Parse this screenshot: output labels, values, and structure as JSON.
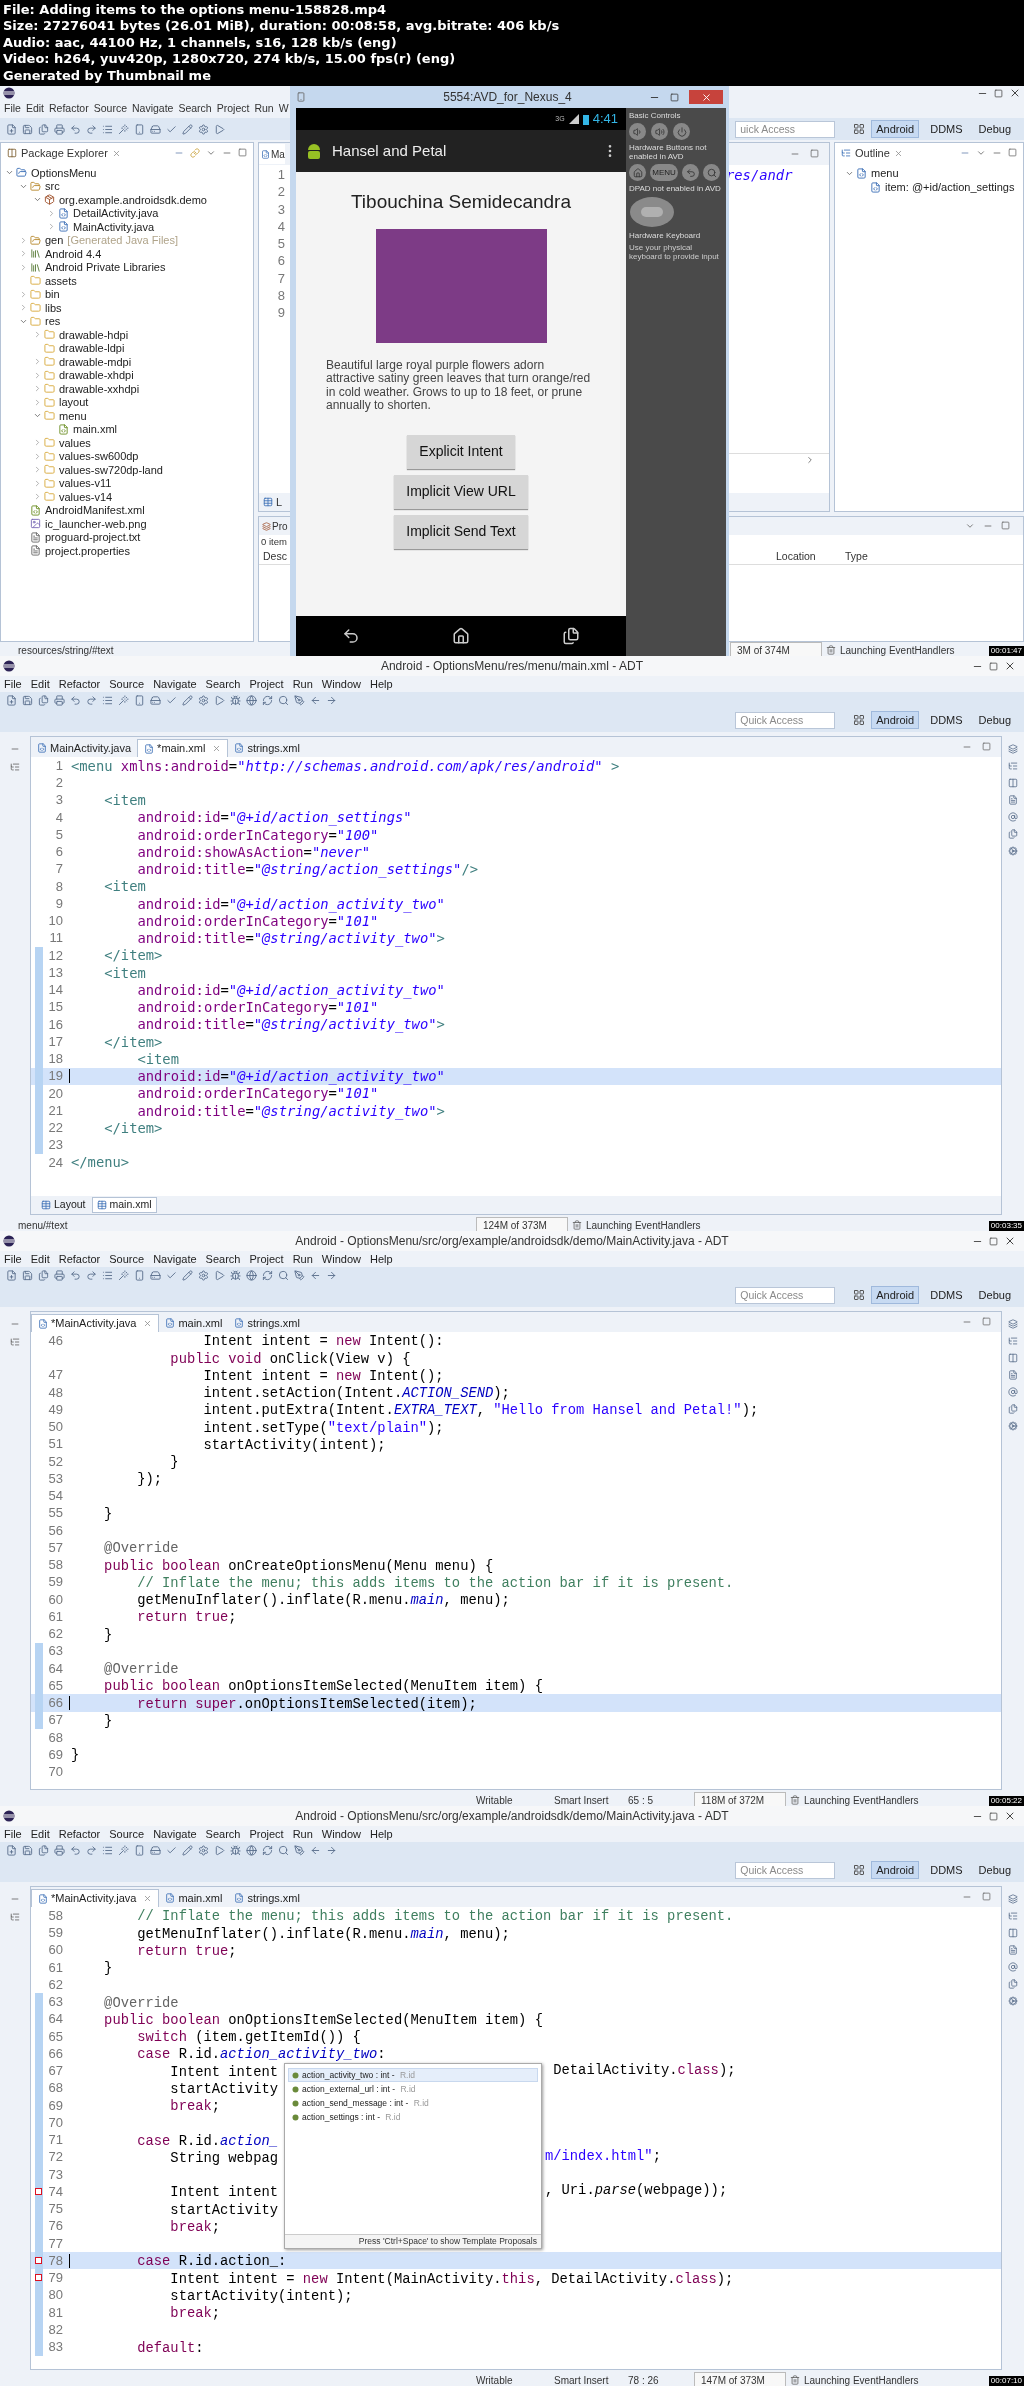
{
  "header": [
    "File: Adding items to the options menu-158828.mp4",
    "Size: 27276041 bytes (26.01 MiB), duration: 00:08:58, avg.bitrate: 406 kb/s",
    "Audio: aac, 44100 Hz, 1 channels, s16, 128 kb/s (eng)",
    "Video: h264, yuv420p, 1280x720, 274 kb/s, 15.00 fps(r) (eng)",
    "Generated by Thumbnail me"
  ],
  "frames": [
    {
      "kind": "emulator",
      "timestamp": "00:01:47",
      "ide": {
        "menu": [
          "File",
          "Edit",
          "Refactor",
          "Source",
          "Navigate",
          "Search",
          "Project",
          "Run",
          "W"
        ],
        "package_explorer": {
          "title": "Package Explorer",
          "tree": [
            {
              "label": "OptionsMenu",
              "kind": "project",
              "expanded": true,
              "children": [
                {
                  "label": "src",
                  "kind": "source-folder",
                  "expanded": true,
                  "children": [
                    {
                      "label": "org.example.androidsdk.demo",
                      "kind": "package",
                      "expanded": true,
                      "children": [
                        {
                          "label": "DetailActivity.java",
                          "kind": "java",
                          "expanded": false
                        },
                        {
                          "label": "MainActivity.java",
                          "kind": "java",
                          "expanded": false
                        }
                      ]
                    }
                  ]
                },
                {
                  "label": "gen",
                  "note": "[Generated Java Files]",
                  "kind": "source-folder",
                  "expanded": false
                },
                {
                  "label": "Android 4.4",
                  "kind": "library",
                  "expanded": false
                },
                {
                  "label": "Android Private Libraries",
                  "kind": "library",
                  "expanded": false
                },
                {
                  "label": "assets",
                  "kind": "folder"
                },
                {
                  "label": "bin",
                  "kind": "folder",
                  "expanded": false
                },
                {
                  "label": "libs",
                  "kind": "folder",
                  "expanded": false
                },
                {
                  "label": "res",
                  "kind": "folder",
                  "expanded": true,
                  "children": [
                    {
                      "label": "drawable-hdpi",
                      "kind": "folder",
                      "expanded": false
                    },
                    {
                      "label": "drawable-ldpi",
                      "kind": "folder"
                    },
                    {
                      "label": "drawable-mdpi",
                      "kind": "folder",
                      "expanded": false
                    },
                    {
                      "label": "drawable-xhdpi",
                      "kind": "folder",
                      "expanded": false
                    },
                    {
                      "label": "drawable-xxhdpi",
                      "kind": "folder",
                      "expanded": false
                    },
                    {
                      "label": "layout",
                      "kind": "folder",
                      "expanded": false
                    },
                    {
                      "label": "menu",
                      "kind": "folder",
                      "expanded": true,
                      "children": [
                        {
                          "label": "main.xml",
                          "kind": "xml"
                        }
                      ]
                    },
                    {
                      "label": "values",
                      "kind": "folder",
                      "expanded": false
                    },
                    {
                      "label": "values-sw600dp",
                      "kind": "folder",
                      "expanded": false
                    },
                    {
                      "label": "values-sw720dp-land",
                      "kind": "folder",
                      "expanded": false
                    },
                    {
                      "label": "values-v11",
                      "kind": "folder",
                      "expanded": false
                    },
                    {
                      "label": "values-v14",
                      "kind": "folder",
                      "expanded": false
                    }
                  ]
                },
                {
                  "label": "AndroidManifest.xml",
                  "kind": "xml"
                },
                {
                  "label": "ic_launcher-web.png",
                  "kind": "image"
                },
                {
                  "label": "proguard-project.txt",
                  "kind": "text"
                },
                {
                  "label": "project.properties",
                  "kind": "text"
                }
              ]
            }
          ]
        },
        "editor_tab": "Ma",
        "line_numbers": [
          "1",
          "2",
          "3",
          "4",
          "5",
          "6",
          "7",
          "8",
          "9"
        ],
        "editor_fragment": "res/andr",
        "bottom_tab": "L",
        "quick_access": {
          "placeholder": "uick Access"
        },
        "perspectives": [
          {
            "label": "Android",
            "selected": true
          },
          {
            "label": "DDMS",
            "selected": false
          },
          {
            "label": "Debug",
            "selected": false
          }
        ],
        "outline": {
          "title": "Outline",
          "tree": [
            {
              "label": "menu",
              "expanded": true,
              "children": [
                {
                  "label": "item: @+id/action_settings"
                }
              ]
            }
          ]
        },
        "problems": {
          "tab": "Pro",
          "count": "0 item",
          "columns": [
            "Desc",
            "Location",
            "Type"
          ]
        },
        "status": {
          "path": "resources/string/#text",
          "memory": "3M of 374M",
          "job": "Launching EventHandlers"
        }
      },
      "emulator": {
        "title": "5554:AVD_for_Nexus_4",
        "network": "3G",
        "time": "4:41",
        "app_title": "Hansel and Petal",
        "heading": "Tibouchina Semidecandra",
        "description": "Beautiful large royal purple flowers adorn attractive satiny green leaves that turn orange/red in cold weather. Grows to up to 18 feet, or prune annually to shorten.",
        "buttons": [
          "Explicit Intent",
          "Implicit View URL",
          "Implicit Send Text"
        ],
        "controls": {
          "basic": "Basic Controls",
          "hardware": "Hardware Buttons not enabled in AVD",
          "menu_key": "MENU",
          "dpad": "DPAD not enabled in AVD",
          "keyboard": "Hardware Keyboard",
          "keyboard_hint": "Use your physical keyboard to provide input"
        }
      }
    },
    {
      "kind": "xml-editor",
      "timestamp": "00:03:35",
      "title": "Android - OptionsMenu/res/menu/main.xml - ADT",
      "menu": [
        "File",
        "Edit",
        "Refactor",
        "Source",
        "Navigate",
        "Search",
        "Project",
        "Run",
        "Window",
        "Help"
      ],
      "quick_access": {
        "placeholder": "Quick Access"
      },
      "perspectives": [
        {
          "label": "Android",
          "selected": true
        },
        {
          "label": "DDMS",
          "selected": false
        },
        {
          "label": "Debug",
          "selected": false
        }
      ],
      "tabs": [
        {
          "label": "MainActivity.java",
          "selected": false
        },
        {
          "label": "*main.xml",
          "selected": true
        },
        {
          "label": "strings.xml",
          "selected": false
        }
      ],
      "lines": [
        {
          "number": "1",
          "changed": false,
          "current": false,
          "segments": [
            {
              "text": "<menu",
              "kind": "tag"
            },
            {
              "text": " xmlns:android",
              "kind": "attr"
            },
            {
              "text": "=",
              "kind": "plain"
            },
            {
              "text": "\"http://schemas.android.com/apk/res/android\"",
              "kind": "value"
            },
            {
              "text": " >",
              "kind": "tag"
            }
          ]
        },
        {
          "number": "2",
          "changed": false,
          "current": false
        },
        {
          "number": "3",
          "changed": false,
          "current": false,
          "segments": [
            {
              "text": "    <item",
              "kind": "tag"
            }
          ]
        },
        {
          "number": "4",
          "changed": false,
          "current": false,
          "segments": [
            {
              "text": "        android:id",
              "kind": "attr"
            },
            {
              "text": "=",
              "kind": "plain"
            },
            {
              "text": "\"@+id/action_settings\"",
              "kind": "value"
            }
          ]
        },
        {
          "number": "5",
          "changed": false,
          "current": false,
          "segments": [
            {
              "text": "        android:orderInCategory",
              "kind": "attr"
            },
            {
              "text": "=",
              "kind": "plain"
            },
            {
              "text": "\"100\"",
              "kind": "value"
            }
          ]
        },
        {
          "number": "6",
          "changed": false,
          "current": false,
          "segments": [
            {
              "text": "        android:showAsAction",
              "kind": "attr"
            },
            {
              "text": "=",
              "kind": "plain"
            },
            {
              "text": "\"never\"",
              "kind": "value"
            }
          ]
        },
        {
          "number": "7",
          "changed": false,
          "current": false,
          "segments": [
            {
              "text": "        android:title",
              "kind": "attr"
            },
            {
              "text": "=",
              "kind": "plain"
            },
            {
              "text": "\"@string/action_settings\"",
              "kind": "value"
            },
            {
              "text": "/>",
              "kind": "tag"
            }
          ]
        },
        {
          "number": "8",
          "changed": false,
          "current": false,
          "segments": [
            {
              "text": "    <item",
              "kind": "tag"
            }
          ]
        },
        {
          "number": "9",
          "changed": false,
          "current": false,
          "segments": [
            {
              "text": "        android:id",
              "kind": "attr"
            },
            {
              "text": "=",
              "kind": "plain"
            },
            {
              "text": "\"@+id/action_activity_two\"",
              "kind": "value"
            }
          ]
        },
        {
          "number": "10",
          "changed": false,
          "current": false,
          "segments": [
            {
              "text": "        android:orderInCategory",
              "kind": "attr"
            },
            {
              "text": "=",
              "kind": "plain"
            },
            {
              "text": "\"101\"",
              "kind": "value"
            }
          ]
        },
        {
          "number": "11",
          "changed": false,
          "current": false,
          "segments": [
            {
              "text": "        android:title",
              "kind": "attr"
            },
            {
              "text": "=",
              "kind": "plain"
            },
            {
              "text": "\"@string/activity_two\"",
              "kind": "value"
            },
            {
              "text": ">",
              "kind": "tag"
            }
          ]
        },
        {
          "number": "12",
          "changed": true,
          "current": false,
          "segments": [
            {
              "text": "    </item>",
              "kind": "tag"
            }
          ]
        },
        {
          "number": "13",
          "changed": true,
          "current": false,
          "segments": [
            {
              "text": "    <item",
              "kind": "tag"
            }
          ]
        },
        {
          "number": "14",
          "changed": true,
          "current": false,
          "segments": [
            {
              "text": "        android:id",
              "kind": "attr"
            },
            {
              "text": "=",
              "kind": "plain"
            },
            {
              "text": "\"@+id/action_activity_two\"",
              "kind": "value"
            }
          ]
        },
        {
          "number": "15",
          "changed": true,
          "current": false,
          "segments": [
            {
              "text": "        android:orderInCategory",
              "kind": "attr"
            },
            {
              "text": "=",
              "kind": "plain"
            },
            {
              "text": "\"101\"",
              "kind": "value"
            }
          ]
        },
        {
          "number": "16",
          "changed": true,
          "current": false,
          "segments": [
            {
              "text": "        android:title",
              "kind": "attr"
            },
            {
              "text": "=",
              "kind": "plain"
            },
            {
              "text": "\"@string/activity_two\"",
              "kind": "value"
            },
            {
              "text": ">",
              "kind": "tag"
            }
          ]
        },
        {
          "number": "17",
          "changed": true,
          "current": false,
          "segments": [
            {
              "text": "    </item>",
              "kind": "tag"
            }
          ]
        },
        {
          "number": "18",
          "changed": true,
          "current": false,
          "segments": [
            {
              "text": "        <item",
              "kind": "tag"
            }
          ]
        },
        {
          "number": "19",
          "changed": true,
          "current": true,
          "segments": [
            {
              "text": "        android:id",
              "kind": "attr"
            },
            {
              "text": "=",
              "kind": "plain"
            },
            {
              "text": "\"@+id/action_activity_two\"",
              "kind": "value"
            }
          ]
        },
        {
          "number": "20",
          "changed": true,
          "current": false,
          "segments": [
            {
              "text": "        android:orderInCategory",
              "kind": "attr"
            },
            {
              "text": "=",
              "kind": "plain"
            },
            {
              "text": "\"101\"",
              "kind": "value"
            }
          ]
        },
        {
          "number": "21",
          "changed": true,
          "current": false,
          "segments": [
            {
              "text": "        android:title",
              "kind": "attr"
            },
            {
              "text": "=",
              "kind": "plain"
            },
            {
              "text": "\"@string/activity_two\"",
              "kind": "value"
            },
            {
              "text": ">",
              "kind": "tag"
            }
          ]
        },
        {
          "number": "22",
          "changed": true,
          "current": false,
          "segments": [
            {
              "text": "    </item>",
              "kind": "tag"
            }
          ]
        },
        {
          "number": "23",
          "changed": true,
          "current": false
        },
        {
          "number": "24",
          "changed": false,
          "current": false,
          "segments": [
            {
              "text": "</menu>",
              "kind": "tag"
            }
          ]
        }
      ],
      "bottom_tabs": [
        {
          "label": "Layout",
          "selected": false
        },
        {
          "label": "main.xml",
          "selected": true
        }
      ],
      "status": {
        "path": "menu/#text",
        "memory": "124M of 373M",
        "job": "Launching EventHandlers"
      }
    },
    {
      "kind": "java-editor",
      "timestamp": "00:05:22",
      "title": "Android - OptionsMenu/src/org/example/androidsdk/demo/MainActivity.java - ADT",
      "menu": [
        "File",
        "Edit",
        "Refactor",
        "Source",
        "Navigate",
        "Search",
        "Project",
        "Run",
        "Window",
        "Help"
      ],
      "quick_access": {
        "placeholder": "Quick Access"
      },
      "perspectives": [
        {
          "label": "Android",
          "selected": true
        },
        {
          "label": "DDMS",
          "selected": false
        },
        {
          "label": "Debug",
          "selected": false
        }
      ],
      "tabs": [
        {
          "label": "*MainActivity.java",
          "selected": true
        },
        {
          "label": "main.xml",
          "selected": false
        },
        {
          "label": "strings.xml",
          "selected": false
        }
      ],
      "lines": [
        {
          "number": "46",
          "changed": false,
          "current": false,
          "segments": [
            {
              "text": "                Intent intent = ",
              "kind": "plain"
            },
            {
              "text": "new",
              "kind": "keyword"
            },
            {
              "text": " Intent():",
              "kind": "plain"
            }
          ]
        },
        {
          "changed": false,
          "current": false,
          "segments": [
            {
              "text": "            public void",
              "kind": "keyword"
            },
            {
              "text": " onClick(View v) {",
              "kind": "plain"
            }
          ]
        },
        {
          "number": "47",
          "changed": false,
          "current": false,
          "segments": [
            {
              "text": "                Intent intent = ",
              "kind": "plain"
            },
            {
              "text": "new",
              "kind": "keyword"
            },
            {
              "text": " Intent();",
              "kind": "plain"
            }
          ]
        },
        {
          "number": "48",
          "changed": false,
          "current": false,
          "segments": [
            {
              "text": "                intent.setAction(Intent.",
              "kind": "plain"
            },
            {
              "text": "ACTION_SEND",
              "kind": "field"
            },
            {
              "text": ");",
              "kind": "plain"
            }
          ]
        },
        {
          "number": "49",
          "changed": false,
          "current": false,
          "segments": [
            {
              "text": "                intent.putExtra(Intent.",
              "kind": "plain"
            },
            {
              "text": "EXTRA_TEXT",
              "kind": "field"
            },
            {
              "text": ", ",
              "kind": "plain"
            },
            {
              "text": "\"Hello from Hansel and Petal!\"",
              "kind": "string"
            },
            {
              "text": ");",
              "kind": "plain"
            }
          ]
        },
        {
          "number": "50",
          "changed": false,
          "current": false,
          "segments": [
            {
              "text": "                intent.setType(",
              "kind": "plain"
            },
            {
              "text": "\"text/plain\"",
              "kind": "string"
            },
            {
              "text": ");",
              "kind": "plain"
            }
          ]
        },
        {
          "number": "51",
          "changed": false,
          "current": false,
          "segments": [
            {
              "text": "                startActivity(intent);",
              "kind": "plain"
            }
          ]
        },
        {
          "number": "52",
          "changed": false,
          "current": false,
          "segments": [
            {
              "text": "            }",
              "kind": "plain"
            }
          ]
        },
        {
          "number": "53",
          "changed": false,
          "current": false,
          "segments": [
            {
              "text": "        });",
              "kind": "plain"
            }
          ]
        },
        {
          "number": "54",
          "changed": false,
          "current": false
        },
        {
          "number": "55",
          "changed": false,
          "current": false,
          "segments": [
            {
              "text": "    }",
              "kind": "plain"
            }
          ]
        },
        {
          "number": "56",
          "changed": false,
          "current": false
        },
        {
          "number": "57",
          "changed": false,
          "current": false,
          "segments": [
            {
              "text": "    @Override",
              "kind": "annotation"
            }
          ]
        },
        {
          "number": "58",
          "changed": false,
          "current": false,
          "segments": [
            {
              "text": "    public boolean",
              "kind": "keyword"
            },
            {
              "text": " onCreateOptionsMenu(Menu menu) {",
              "kind": "plain"
            }
          ]
        },
        {
          "number": "59",
          "changed": false,
          "current": false,
          "segments": [
            {
              "text": "        // Inflate the menu; this adds items to the action bar if it is present.",
              "kind": "comment"
            }
          ]
        },
        {
          "number": "60",
          "changed": false,
          "current": false,
          "segments": [
            {
              "text": "        getMenuInflater().inflate(R.menu.",
              "kind": "plain"
            },
            {
              "text": "main",
              "kind": "field"
            },
            {
              "text": ", menu);",
              "kind": "plain"
            }
          ]
        },
        {
          "number": "61",
          "changed": false,
          "current": false,
          "segments": [
            {
              "text": "        return true",
              "kind": "keyword"
            },
            {
              "text": ";",
              "kind": "plain"
            }
          ]
        },
        {
          "number": "62",
          "changed": false,
          "current": false,
          "segments": [
            {
              "text": "    }",
              "kind": "plain"
            }
          ]
        },
        {
          "number": "63",
          "changed": true,
          "current": false
        },
        {
          "number": "64",
          "changed": true,
          "current": false,
          "segments": [
            {
              "text": "    @Override",
              "kind": "annotation"
            }
          ]
        },
        {
          "number": "65",
          "changed": true,
          "current": false,
          "segments": [
            {
              "text": "    public boolean",
              "kind": "keyword"
            },
            {
              "text": " onOptionsItemSelected(MenuItem item) {",
              "kind": "plain"
            }
          ]
        },
        {
          "number": "66",
          "changed": true,
          "current": true,
          "segments": [
            {
              "text": "        return super",
              "kind": "keyword"
            },
            {
              "text": ".onOptionsItemSelected(item);",
              "kind": "plain"
            }
          ]
        },
        {
          "number": "67",
          "changed": true,
          "current": false,
          "segments": [
            {
              "text": "    }",
              "kind": "plain"
            }
          ]
        },
        {
          "number": "68",
          "changed": false,
          "current": false
        },
        {
          "number": "69",
          "changed": false,
          "current": false,
          "segments": [
            {
              "text": "}",
              "kind": "plain"
            }
          ]
        },
        {
          "number": "70",
          "changed": false,
          "current": false
        }
      ],
      "status": {
        "writable": "Writable",
        "insert_mode": "Smart Insert",
        "position": "65 : 5",
        "memory": "118M of 372M",
        "job": "Launching EventHandlers"
      }
    },
    {
      "kind": "java-editor",
      "timestamp": "00:07:10",
      "title": "Android - OptionsMenu/src/org/example/androidsdk/demo/MainActivity.java - ADT",
      "menu": [
        "File",
        "Edit",
        "Refactor",
        "Source",
        "Navigate",
        "Search",
        "Project",
        "Run",
        "Window",
        "Help"
      ],
      "quick_access": {
        "placeholder": "Quick Access"
      },
      "perspectives": [
        {
          "label": "Android",
          "selected": true
        },
        {
          "label": "DDMS",
          "selected": false
        },
        {
          "label": "Debug",
          "selected": false
        }
      ],
      "tabs": [
        {
          "label": "*MainActivity.java",
          "selected": true
        },
        {
          "label": "main.xml",
          "selected": false
        },
        {
          "label": "strings.xml",
          "selected": false
        }
      ],
      "lines": [
        {
          "number": "58",
          "changed": false,
          "current": false,
          "error": false,
          "segments": [
            {
              "text": "        // Inflate the menu; this adds items to the action bar if it is present.",
              "kind": "comment"
            }
          ]
        },
        {
          "number": "59",
          "changed": false,
          "current": false,
          "error": false,
          "segments": [
            {
              "text": "        getMenuInflater().inflate(R.menu.",
              "kind": "plain"
            },
            {
              "text": "main",
              "kind": "field"
            },
            {
              "text": ", menu);",
              "kind": "plain"
            }
          ]
        },
        {
          "number": "60",
          "changed": false,
          "current": false,
          "error": false,
          "segments": [
            {
              "text": "        return true",
              "kind": "keyword"
            },
            {
              "text": ";",
              "kind": "plain"
            }
          ]
        },
        {
          "number": "61",
          "changed": false,
          "current": false,
          "error": false,
          "segments": [
            {
              "text": "    }",
              "kind": "plain"
            }
          ]
        },
        {
          "number": "62",
          "changed": false,
          "current": false,
          "error": false
        },
        {
          "number": "63",
          "changed": true,
          "current": false,
          "error": false,
          "segments": [
            {
              "text": "    @Override",
              "kind": "annotation"
            }
          ]
        },
        {
          "number": "64",
          "changed": true,
          "current": false,
          "error": false,
          "segments": [
            {
              "text": "    public boolean",
              "kind": "keyword"
            },
            {
              "text": " onOptionsItemSelected(MenuItem item) {",
              "kind": "plain"
            }
          ]
        },
        {
          "number": "65",
          "changed": true,
          "current": false,
          "error": false,
          "segments": [
            {
              "text": "        switch",
              "kind": "keyword"
            },
            {
              "text": " (item.getItemId()) {",
              "kind": "plain"
            }
          ]
        },
        {
          "number": "66",
          "changed": true,
          "current": false,
          "error": false,
          "segments": [
            {
              "text": "        case",
              "kind": "keyword"
            },
            {
              "text": " R.id.",
              "kind": "plain"
            },
            {
              "text": "action_activity_two",
              "kind": "field"
            },
            {
              "text": ":",
              "kind": "plain"
            }
          ]
        },
        {
          "number": "67",
          "changed": true,
          "current": false,
          "error": false,
          "segments": [
            {
              "text": "            Intent intent",
              "kind": "plain"
            }
          ],
          "right": [
            {
              "text": " DetailActivity.",
              "kind": "plain"
            },
            {
              "text": "class",
              "kind": "keyword"
            },
            {
              "text": ");",
              "kind": "plain"
            }
          ]
        },
        {
          "number": "68",
          "changed": true,
          "current": false,
          "error": false,
          "segments": [
            {
              "text": "            startActivity",
              "kind": "plain"
            }
          ]
        },
        {
          "number": "69",
          "changed": true,
          "current": false,
          "error": false,
          "segments": [
            {
              "text": "            break",
              "kind": "keyword"
            },
            {
              "text": ";",
              "kind": "plain"
            }
          ]
        },
        {
          "number": "70",
          "changed": true,
          "current": false,
          "error": false
        },
        {
          "number": "71",
          "changed": true,
          "current": false,
          "error": false,
          "segments": [
            {
              "text": "        case",
              "kind": "keyword"
            },
            {
              "text": " R.id.",
              "kind": "plain"
            },
            {
              "text": "action_",
              "kind": "field"
            }
          ]
        },
        {
          "number": "72",
          "changed": true,
          "current": false,
          "error": false,
          "segments": [
            {
              "text": "            String webpag",
              "kind": "plain"
            }
          ],
          "right": [
            {
              "text": "m/index.html\"",
              "kind": "string"
            },
            {
              "text": ";",
              "kind": "plain"
            }
          ]
        },
        {
          "number": "73",
          "changed": true,
          "current": false,
          "error": false
        },
        {
          "number": "74",
          "changed": true,
          "current": false,
          "error": true,
          "segments": [
            {
              "text": "            Intent intent",
              "kind": "plain"
            }
          ],
          "right": [
            {
              "text": ", Uri.",
              "kind": "plain"
            },
            {
              "text": "parse",
              "kind": "method"
            },
            {
              "text": "(webpage));",
              "kind": "plain"
            }
          ]
        },
        {
          "number": "75",
          "changed": true,
          "current": false,
          "error": false,
          "segments": [
            {
              "text": "            startActivity",
              "kind": "plain"
            }
          ]
        },
        {
          "number": "76",
          "changed": true,
          "current": false,
          "error": false,
          "segments": [
            {
              "text": "            break",
              "kind": "keyword"
            },
            {
              "text": ";",
              "kind": "plain"
            }
          ]
        },
        {
          "number": "77",
          "changed": true,
          "current": false,
          "error": false
        },
        {
          "number": "78",
          "changed": true,
          "current": true,
          "error": true,
          "segments": [
            {
              "text": "        case",
              "kind": "keyword"
            },
            {
              "text": " R.id.action_:",
              "kind": "plain"
            }
          ]
        },
        {
          "number": "79",
          "changed": true,
          "current": false,
          "error": true,
          "segments": [
            {
              "text": "            Intent intent = ",
              "kind": "plain"
            },
            {
              "text": "new",
              "kind": "keyword"
            },
            {
              "text": " Intent(MainActivity.",
              "kind": "plain"
            },
            {
              "text": "this",
              "kind": "keyword"
            },
            {
              "text": ", DetailActivity.",
              "kind": "plain"
            },
            {
              "text": "class",
              "kind": "keyword"
            },
            {
              "text": ");",
              "kind": "plain"
            }
          ]
        },
        {
          "number": "80",
          "changed": true,
          "current": false,
          "error": false,
          "segments": [
            {
              "text": "            startActivity(intent);",
              "kind": "plain"
            }
          ]
        },
        {
          "number": "81",
          "changed": true,
          "current": false,
          "error": false,
          "segments": [
            {
              "text": "            break",
              "kind": "keyword"
            },
            {
              "text": ";",
              "kind": "plain"
            }
          ]
        },
        {
          "number": "82",
          "changed": true,
          "current": false,
          "error": false
        },
        {
          "number": "83",
          "changed": true,
          "current": false,
          "error": false,
          "segments": [
            {
              "text": "        default",
              "kind": "keyword"
            },
            {
              "text": ":",
              "kind": "plain"
            }
          ]
        }
      ],
      "popup": {
        "items": [
          {
            "label": "action_activity_two : int - ",
            "qualifier": "R.id",
            "selected": true
          },
          {
            "label": "action_external_url : int - ",
            "qualifier": "R.id",
            "selected": false
          },
          {
            "label": "action_send_message : int - ",
            "qualifier": "R.id",
            "selected": false
          },
          {
            "label": "action_settings : int - ",
            "qualifier": "R.id",
            "selected": false
          }
        ],
        "footer": "Press 'Ctrl+Space' to show Template Proposals"
      },
      "status": {
        "writable": "Writable",
        "insert_mode": "Smart Insert",
        "position": "78 : 26",
        "memory": "147M of 373M",
        "job": "Launching EventHandlers"
      }
    }
  ]
}
